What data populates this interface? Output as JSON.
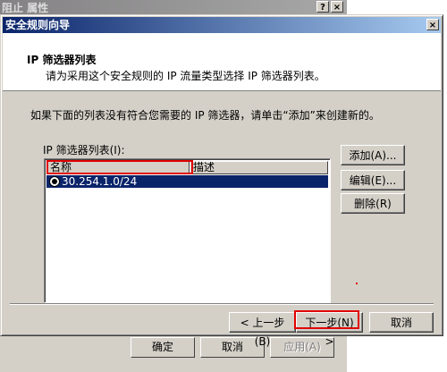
{
  "background_window": {
    "title": "阻止 属性",
    "help_btn": "?",
    "close_btn": "×",
    "ok_label": "确定",
    "cancel_label": "取消",
    "apply_label": "应用(A)"
  },
  "dialog": {
    "title": "安全规则向导",
    "close_btn": "×",
    "header_title": "IP 筛选器列表",
    "header_subtitle": "请为采用这个安全规则的 IP 流量类型选择 IP 筛选器列表。",
    "instruction": "如果下面的列表没有符合您需要的 IP 筛选器，请单击“添加”来创建新的。",
    "list_label": "IP 筛选器列表(I):",
    "columns": [
      "名称",
      "描述"
    ],
    "rows": [
      {
        "name": "30.254.1.0/24",
        "description": "",
        "selected": true
      }
    ],
    "buttons": {
      "add": "添加(A)...",
      "edit": "编辑(E)...",
      "delete": "删除(R)",
      "back": "< 上一步(B)",
      "next": "下一步(N) >",
      "cancel": "取消"
    }
  },
  "colors": {
    "titlebar_active": "#0a246a",
    "titlebar_gradient_end": "#a6caf0",
    "face": "#d4d0c8",
    "highlight_red": "#e00000"
  }
}
